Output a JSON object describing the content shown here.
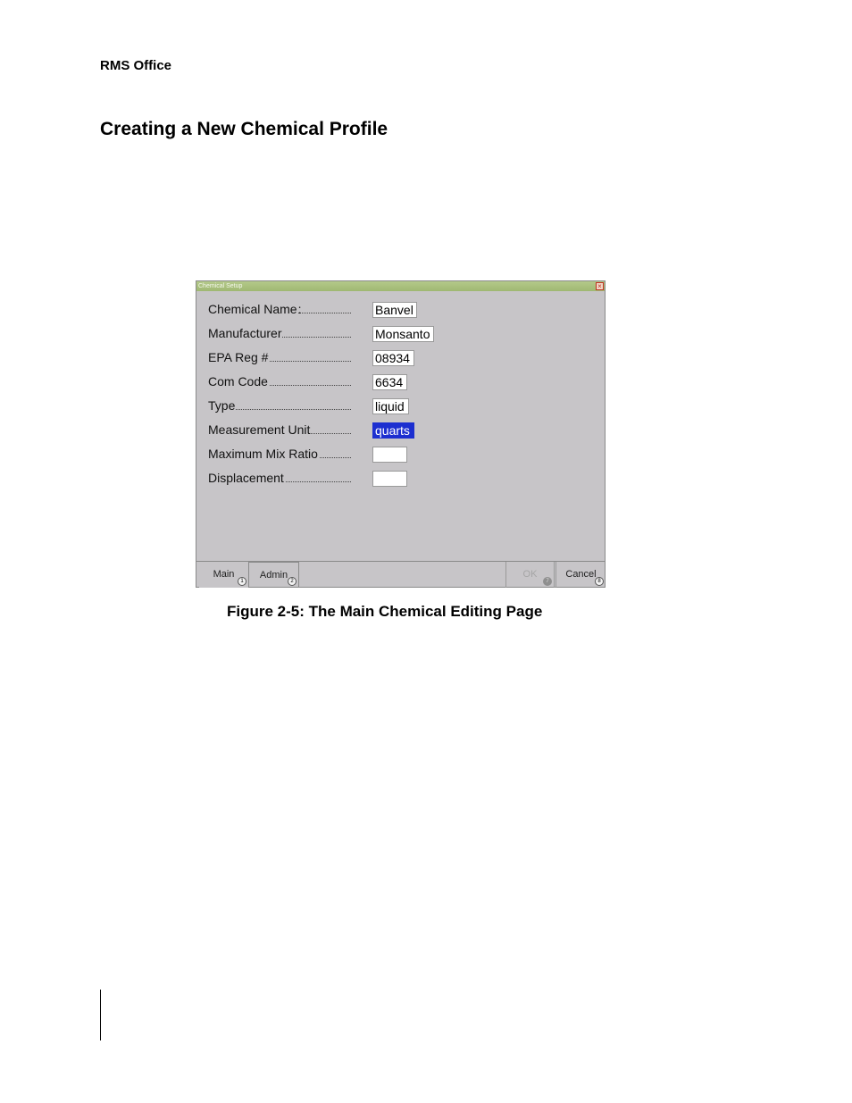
{
  "page": {
    "running_head": "RMS Office",
    "section_title": "Creating a New Chemical Profile",
    "caption": "Figure 2-5: The Main Chemical Editing Page"
  },
  "dialog": {
    "title": "Chemical Setup",
    "close_glyph": "×",
    "fields": [
      {
        "label": "Chemical Name",
        "value": "Banvel"
      },
      {
        "label": "Manufacturer",
        "value": "Monsanto"
      },
      {
        "label": "EPA Reg #",
        "value": "08934"
      },
      {
        "label": "Com Code",
        "value": "6634"
      },
      {
        "label": "Type",
        "value": "liquid"
      },
      {
        "label": "Measurement Unit",
        "value": "quarts"
      },
      {
        "label": "Maximum Mix Ratio",
        "value": ""
      },
      {
        "label": "Displacement",
        "value": ""
      }
    ],
    "tabs": [
      {
        "label": "Main",
        "badge": "1"
      },
      {
        "label": "Admin",
        "badge": "2"
      }
    ],
    "buttons": {
      "ok": {
        "label": "OK",
        "badge": "7"
      },
      "cancel": {
        "label": "Cancel",
        "badge": "8"
      }
    }
  },
  "colors": {
    "dialog_bg": "#c7c5c8",
    "selection": "#1c2fd0",
    "titlebar": "#a8bf7c"
  }
}
